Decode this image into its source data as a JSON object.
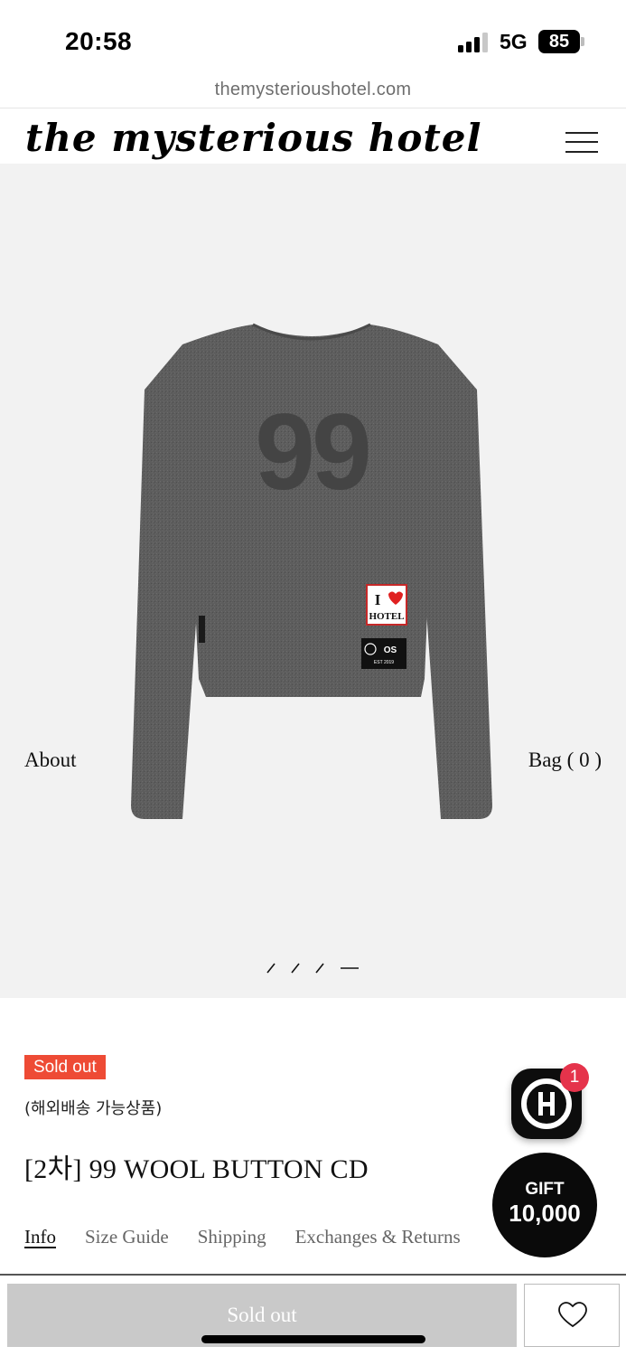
{
  "status_bar": {
    "time": "20:58",
    "network": "5G",
    "battery": "85"
  },
  "browser": {
    "url": "themysterioushotel.com"
  },
  "header": {
    "logo": "the mysterious hotel",
    "menu_icon": "hamburger-menu-icon"
  },
  "hero": {
    "nav_left": "About",
    "nav_right": "Bag ( 0 )",
    "image": {
      "print_number": "99",
      "patch_top_line1": "I",
      "patch_top_line2": "HOTEL",
      "patch_bottom_size": "OS",
      "patch_bottom_est": "EST 2019"
    },
    "slide_count": 4,
    "active_slide": 4
  },
  "product": {
    "status_badge": "Sold out",
    "overseas_note": "(해외배송 가능상품)",
    "title": "[2차] 99 WOOL BUTTON CD",
    "tabs": [
      {
        "label": "Info",
        "active": true
      },
      {
        "label": "Size Guide",
        "active": false
      },
      {
        "label": "Shipping",
        "active": false
      },
      {
        "label": "Exchanges & Returns",
        "active": false
      }
    ]
  },
  "footer_actions": {
    "primary_label": "Sold out",
    "wishlist_icon": "heart-icon"
  },
  "floating": {
    "chat_badge_count": "1",
    "gift_label": "GIFT",
    "gift_amount": "10,000"
  },
  "colors": {
    "badge_red": "#ee4b35",
    "hero_bg": "#f2f2f2",
    "button_disabled": "#c9c9c9",
    "notification_red": "#e5334b",
    "sweater_gray": "#5b5b5b"
  }
}
